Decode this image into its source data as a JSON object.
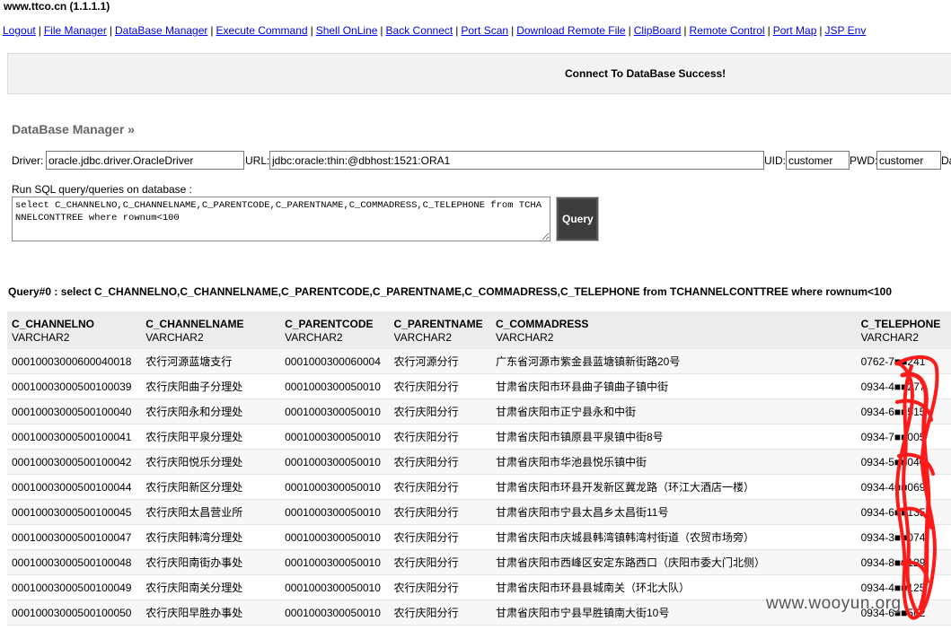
{
  "host": "www.ttco.cn (1.1.1.1)",
  "nav": [
    "Logout",
    "File Manager",
    "DataBase Manager",
    "Execute Command",
    "Shell OnLine",
    "Back Connect",
    "Port Scan",
    "Download Remote File",
    "ClipBoard",
    "Remote Control",
    "Port Map",
    "JSP Env"
  ],
  "banner": "Connect To DataBase Success!",
  "db_title": "DataBase Manager »",
  "conn": {
    "driver_label": "Driver:",
    "driver_value": "oracle.jdbc.driver.OracleDriver",
    "url_label": "URL:",
    "url_value": "jdbc:oracle:thin:@dbhost:1521:ORA1",
    "uid_label": "UID:",
    "uid_value": "customer",
    "pwd_label": "PWD:",
    "pwd_value": "customer",
    "extra_label": "Da"
  },
  "sql_label": "Run SQL query/queries on database :",
  "sql_text": "select C_CHANNELNO,C_CHANNELNAME,C_PARENTCODE,C_PARENTNAME,C_COMMADRESS,C_TELEPHONE from TCHANNELCONTTREE where rownum<100",
  "query_button": "Query",
  "query_title": "Query#0 : select C_CHANNELNO,C_CHANNELNAME,C_PARENTCODE,C_PARENTNAME,C_COMMADRESS,C_TELEPHONE from TCHANNELCONTTREE where rownum<100",
  "table": {
    "columns": [
      "C_CHANNELNO",
      "C_CHANNELNAME",
      "C_PARENTCODE",
      "C_PARENTNAME",
      "C_COMMADRESS",
      "C_TELEPHONE"
    ],
    "types": [
      "VARCHAR2",
      "VARCHAR2",
      "VARCHAR2",
      "VARCHAR2",
      "VARCHAR2",
      "VARCHAR2"
    ],
    "rows": [
      [
        "00010003000600040018",
        "农行河源蓝塘支行",
        "0001000300060004",
        "农行河源分行",
        "广东省河源市紫金县蓝塘镇新街路20号",
        "0762-7■■241"
      ],
      [
        "00010003000500100039",
        "农行庆阳曲子分理处",
        "0001000300050010",
        "农行庆阳分行",
        "甘肃省庆阳市环县曲子镇曲子镇中街",
        "0934-4■■277"
      ],
      [
        "00010003000500100040",
        "农行庆阳永和分理处",
        "0001000300050010",
        "农行庆阳分行",
        "甘肃省庆阳市正宁县永和中街",
        "0934-6■■515"
      ],
      [
        "00010003000500100041",
        "农行庆阳平泉分理处",
        "0001000300050010",
        "农行庆阳分行",
        "甘肃省庆阳市镇原县平泉镇中街8号",
        "0934-7■■005"
      ],
      [
        "00010003000500100042",
        "农行庆阳悦乐分理处",
        "0001000300050010",
        "农行庆阳分行",
        "甘肃省庆阳市华池县悦乐镇中街",
        "0934-5■■040"
      ],
      [
        "00010003000500100044",
        "农行庆阳新区分理处",
        "0001000300050010",
        "农行庆阳分行",
        "甘肃省庆阳市环县开发新区冀龙路（环江大酒店一楼）",
        "0934-4■■069"
      ],
      [
        "00010003000500100045",
        "农行庆阳太昌营业所",
        "0001000300050010",
        "农行庆阳分行",
        "甘肃省庆阳市宁县太昌乡太昌街11号",
        "0934-6■■135"
      ],
      [
        "00010003000500100047",
        "农行庆阳韩湾分理处",
        "0001000300050010",
        "农行庆阳分行",
        "甘肃省庆阳市庆城县韩湾镇韩湾村街道（农贸市场旁）",
        "0934-3■■074"
      ],
      [
        "00010003000500100048",
        "农行庆阳南街办事处",
        "0001000300050010",
        "农行庆阳分行",
        "甘肃省庆阳市西峰区安定东路西口（庆阳市委大门北侧）",
        "0934-8■■129"
      ],
      [
        "00010003000500100049",
        "农行庆阳南关分理处",
        "0001000300050010",
        "农行庆阳分行",
        "甘肃省庆阳市环县县城南关（环北大队）",
        "0934-4■■125"
      ],
      [
        "00010003000500100050",
        "农行庆阳早胜办事处",
        "0001000300050010",
        "农行庆阳分行",
        "甘肃省庆阳市宁县早胜镇南大街10号",
        "0934-6■■562"
      ]
    ]
  },
  "watermark": "www.wooyun.org",
  "colors": {
    "link": "#0000ee",
    "scribble": "#ff1a1a",
    "button": "#3c3c3c"
  }
}
